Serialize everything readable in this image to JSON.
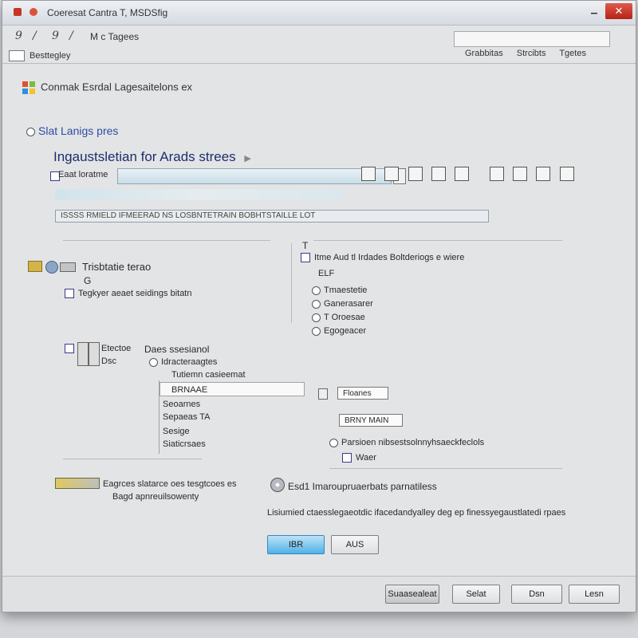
{
  "window": {
    "title": "Coeresat Cantra T, MSDSfig",
    "close_glyph": "✕",
    "min_glyph": "▁",
    "accent": "#4fb1e6",
    "close_color": "#c73525"
  },
  "toolbar": {
    "glyphs": [
      "9",
      "/",
      "9",
      "/"
    ],
    "title": "M c Tagees",
    "search_tabs": [
      "Grabbitas",
      "Strcibts",
      "Tgetes"
    ]
  },
  "addressbar": {
    "label": "Besttegley"
  },
  "header": {
    "text": "Conmak Esrdal Lagesaitelons ex"
  },
  "section_link": "Slat Lanigs pres",
  "page_heading": "Ingaustsletian for Arads strees",
  "field": {
    "label": "Eaat loratme"
  },
  "long_bar_text": "ISSSS RMIELD IFMEERAD  NS LOSBNTETRAIN BOBHTSTAILLE LOT",
  "left_group": {
    "title": "Trisbtatie terao",
    "sub": "G",
    "checkbox_label": "Tegkyer aeaet seidings bitatn"
  },
  "right_group": {
    "title": "Itme Aud tl Irdades Boltderiogs e wiere",
    "header_item": "ELF",
    "items": [
      "Tmaestetie",
      "Ganerasarer",
      "T Oroesae",
      "Egogeacer"
    ]
  },
  "bottom_left": {
    "items": [
      "Etectoe",
      "Dsc"
    ],
    "title": "Daes ssesianol",
    "radio_label": "Idracteraagtes",
    "list_header": "Tutiemn casieemat",
    "list_selected": "BRNAAE",
    "list_items": [
      "Seoarnes",
      "Sepaeas TA",
      "Sesige",
      "Siaticrsaes"
    ]
  },
  "bottom_right": {
    "field1": "Floanes",
    "field2": "BRNY MAIN",
    "line": "Parsioen nibsestsolnnyhsaeckfeclols",
    "checkbox": "Waer"
  },
  "info": {
    "left_line1": "Eagrces slatarce oes tesgtcoes es",
    "left_line2": "Bagd apnreuilsowenty",
    "right_title": "Esd1 Imaroupruaerbats parnatiless",
    "description": "Lisiumied ctaesslegaeotdic ifacedandyalley deg ep finessyegaustlatedi rpaes"
  },
  "buttons": {
    "ok": "IBR",
    "apply": "AUS",
    "advanced": "Suaasealeat",
    "save": "Selat",
    "dsn": "Dsn",
    "close": "Lesn"
  }
}
